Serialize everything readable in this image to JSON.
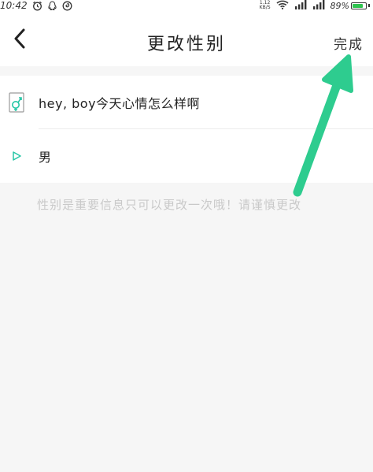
{
  "status_bar": {
    "time": "10:42",
    "net_speed_value": "1.12",
    "net_speed_unit": "KB/S",
    "battery_percent": "89%",
    "battery_level": 0.89
  },
  "nav": {
    "title": "更改性别",
    "done_label": "完成"
  },
  "list": {
    "items": [
      {
        "text": "hey, boy今天心情怎么样啊"
      },
      {
        "text": "男"
      }
    ]
  },
  "hint": "性别是重要信息只可以更改一次哦！请谨慎更改",
  "colors": {
    "accent": "#26c6a6",
    "arrow": "#2ecc8f",
    "battery": "#2fc34f",
    "hint": "#c9c9c9",
    "background": "#f6f6f6"
  },
  "icons": {
    "alarm": "alarm-clock-icon",
    "qq": "qq-penguin-icon",
    "app": "swirl-app-icon",
    "wifi": "wifi-icon",
    "signal": "signal-bars-icon",
    "back": "chevron-left-icon",
    "gender": "gender-symbol-icon",
    "selected": "play-triangle-icon"
  }
}
